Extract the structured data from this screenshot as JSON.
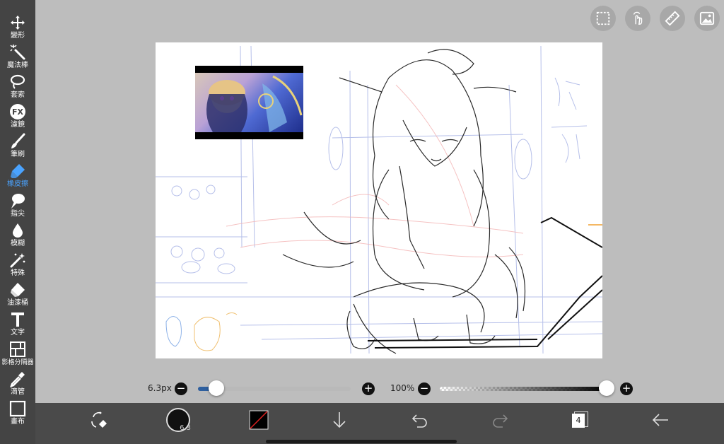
{
  "toolbar": {
    "items": [
      {
        "label": "變形",
        "icon": "move-icon"
      },
      {
        "label": "魔法棒",
        "icon": "magic-wand-icon"
      },
      {
        "label": "套索",
        "icon": "lasso-icon"
      },
      {
        "label": "濾鏡",
        "icon": "fx-icon"
      },
      {
        "label": "筆刷",
        "icon": "brush-icon"
      },
      {
        "label": "橡皮擦",
        "icon": "eraser-icon",
        "active": true
      },
      {
        "label": "指尖",
        "icon": "finger-icon"
      },
      {
        "label": "模糊",
        "icon": "blur-drop-icon"
      },
      {
        "label": "特殊",
        "icon": "special-icon"
      },
      {
        "label": "油漆桶",
        "icon": "paint-bucket-icon"
      },
      {
        "label": "文字",
        "icon": "text-icon"
      },
      {
        "label": "影格分隔器",
        "icon": "frame-divider-icon"
      },
      {
        "label": "滴管",
        "icon": "eyedropper-icon"
      },
      {
        "label": "畫布",
        "icon": "canvas-icon"
      }
    ]
  },
  "top_actions": [
    "selection-icon",
    "touch-icon",
    "ruler-icon",
    "material-icon"
  ],
  "brush": {
    "size_label": "6.3px",
    "size_fraction": 0.12,
    "minus": "−",
    "plus": "+"
  },
  "opacity": {
    "label": "100%",
    "fraction": 1.0,
    "minus": "−",
    "plus": "+"
  },
  "bottom": {
    "brush_size_badge": "6.3",
    "layer_count": "4"
  },
  "colors": {
    "accent": "#4aa3ff",
    "sidebar_bg": "#444444",
    "bottombar_bg": "#4a4a4a",
    "track_fill": "#2e5f9e"
  }
}
